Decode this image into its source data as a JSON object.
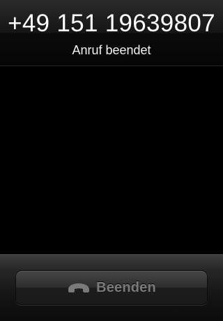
{
  "call": {
    "number": "+49 151 19639807",
    "status": "Anruf beendet"
  },
  "actions": {
    "end_label": "Beenden",
    "end_icon": "phone-hangup-icon"
  },
  "colors": {
    "background": "#000000",
    "button_text": "#7a7a7a"
  }
}
